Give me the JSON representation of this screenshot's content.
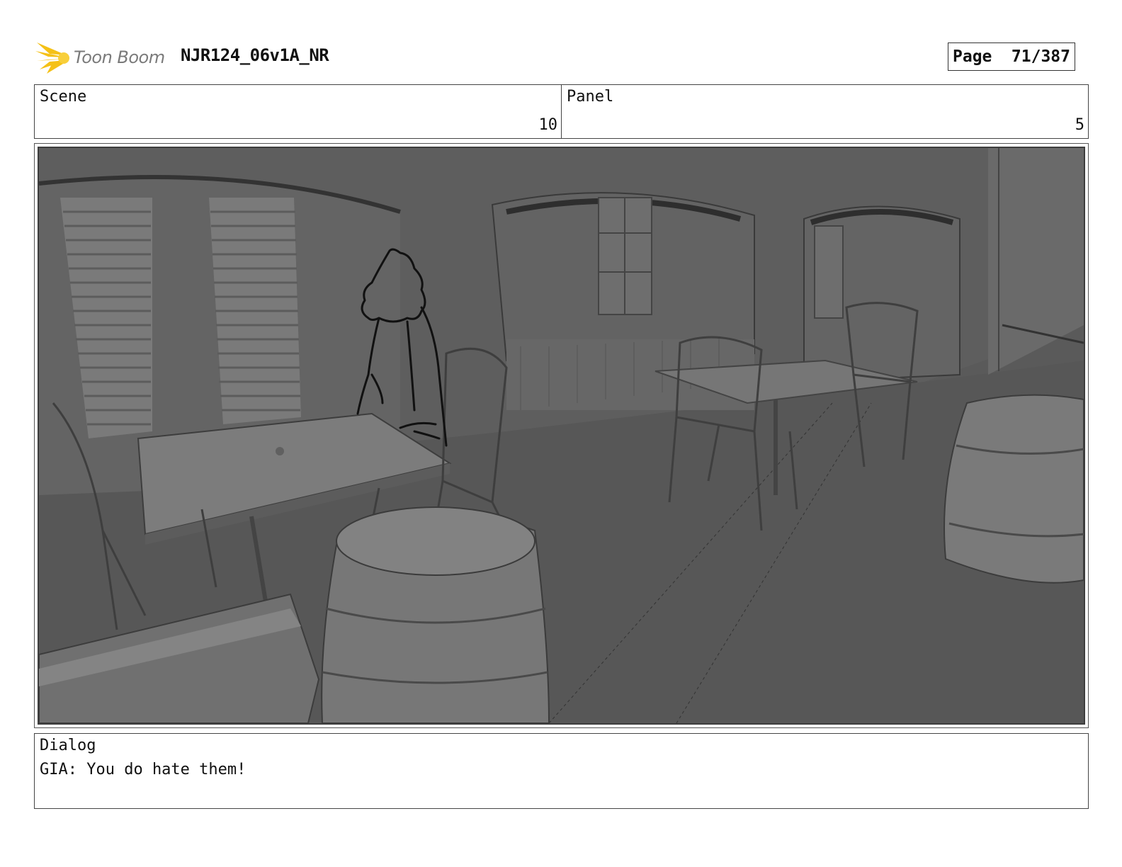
{
  "header": {
    "logo_text": "Toon Boom",
    "doc_title": "NJR124_06v1A_NR",
    "page_label": "Page",
    "page_number": "71/387"
  },
  "info": {
    "scene_label": "Scene",
    "scene_value": "10",
    "panel_label": "Panel",
    "panel_value": "5"
  },
  "dialog": {
    "label": "Dialog",
    "text": "GIA: You do hate them!"
  },
  "colors": {
    "logo_accent": "#f5c116",
    "scene_gray": "#595959"
  }
}
